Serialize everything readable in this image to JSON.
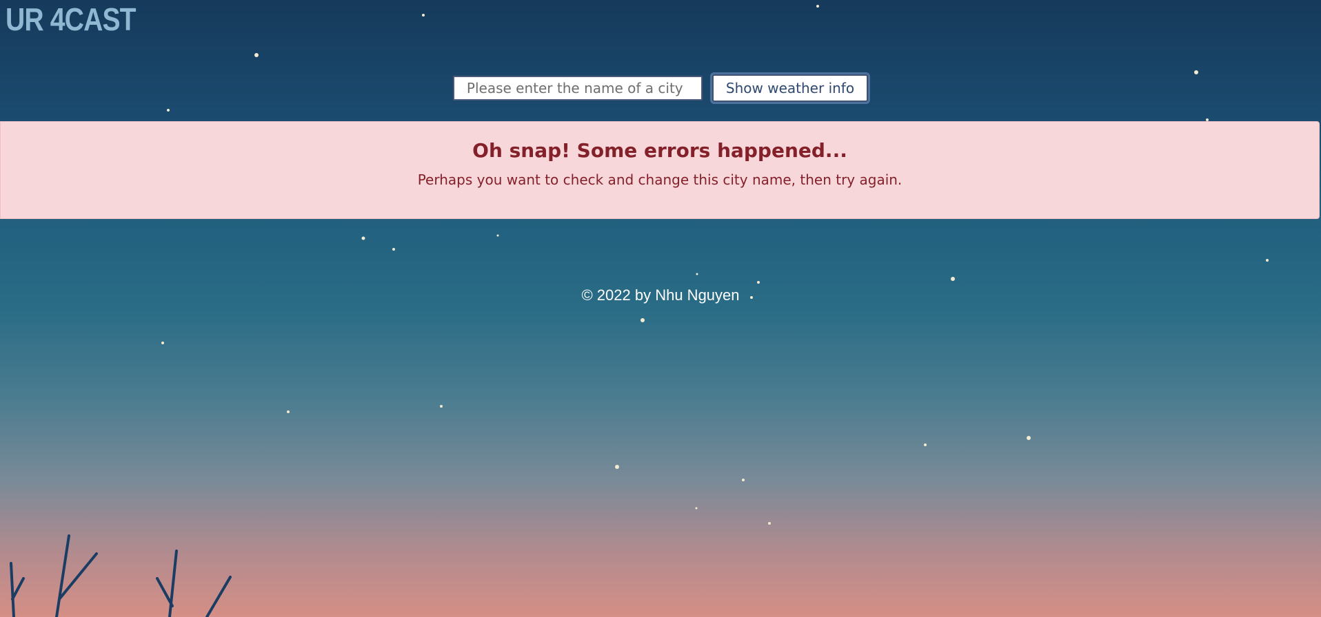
{
  "app": {
    "logo_text": "UR 4CAST"
  },
  "search": {
    "placeholder": "Please enter the name of a city",
    "value": "",
    "button_label": "Show weather info"
  },
  "error_alert": {
    "title": "Oh snap! Some errors happened...",
    "message": "Perhaps you want to check and change this city name, then try again."
  },
  "footer": {
    "text": "© 2022 by Nhu Nguyen"
  },
  "colors": {
    "sky_top": "#163a5b",
    "sky_bottom": "#d58f86",
    "logo": "#8fb8d2",
    "alert_background": "#f8d7da",
    "alert_text": "#842029",
    "button_text": "#2e4870"
  }
}
